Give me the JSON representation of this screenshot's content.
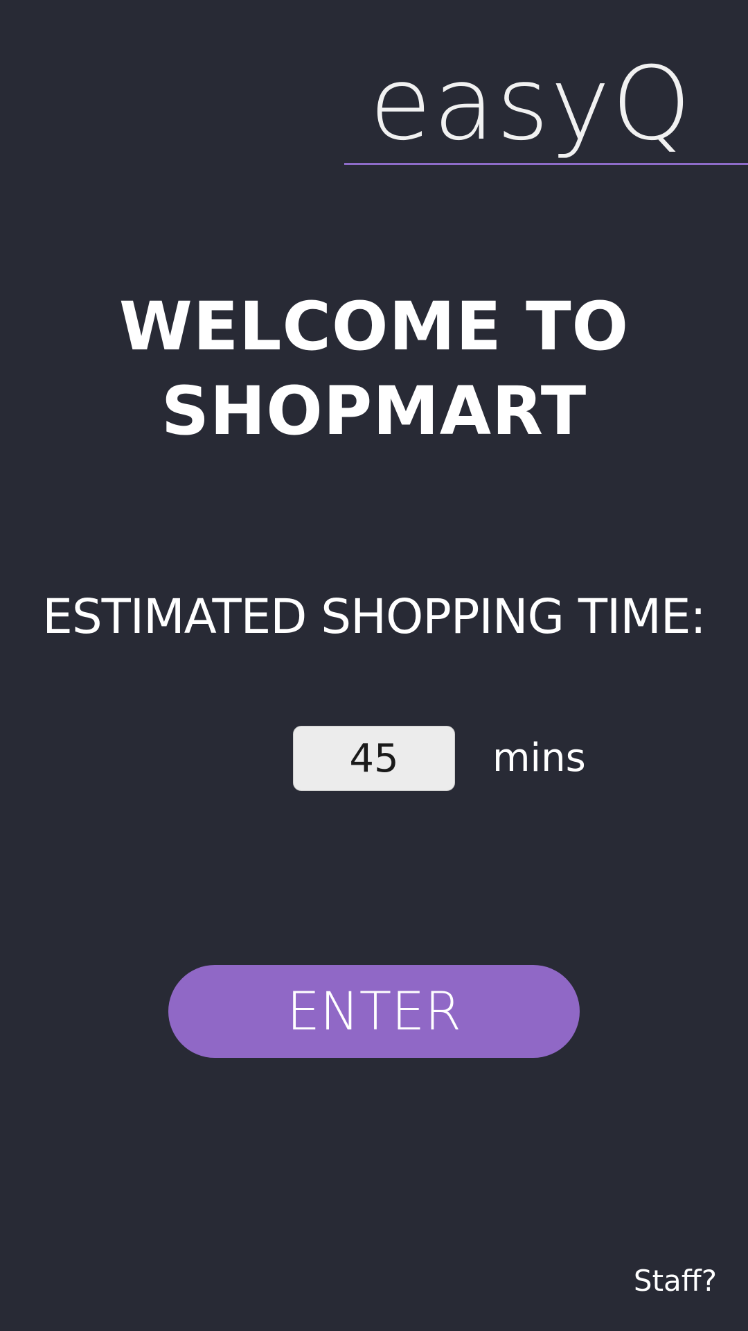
{
  "app": {
    "logo_text": "easyQ"
  },
  "welcome": {
    "line1": "WELCOME TO",
    "line2": "SHOPMART"
  },
  "estimate": {
    "label": "ESTIMATED SHOPPING TIME:",
    "value": "45",
    "unit": "mins"
  },
  "actions": {
    "enter_label": "ENTER",
    "staff_label": "Staff?"
  },
  "colors": {
    "background": "#282a35",
    "accent": "#9068c6",
    "input_background": "#ececec",
    "text": "#ffffff"
  }
}
